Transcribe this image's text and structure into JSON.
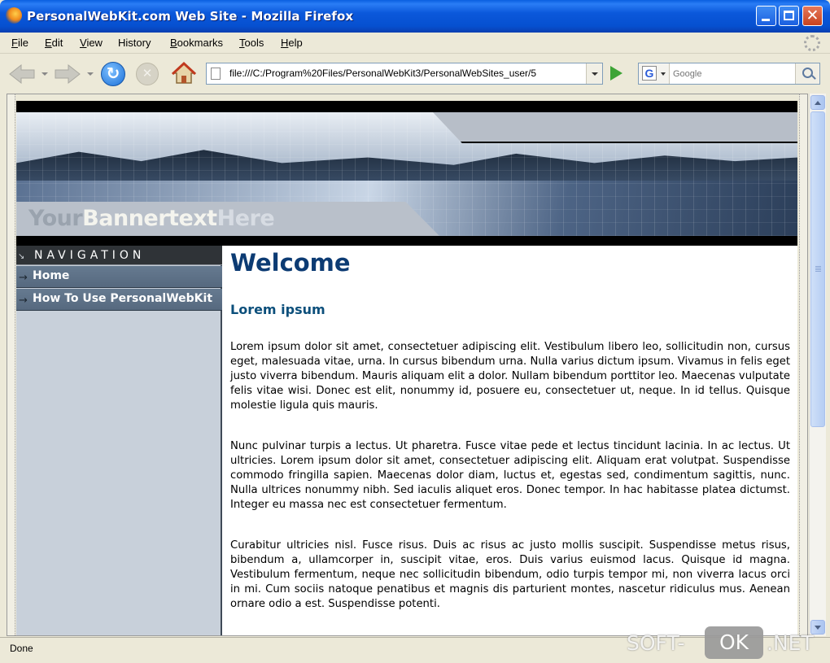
{
  "window": {
    "title": "PersonalWebKit.com Web Site - Mozilla Firefox",
    "close_glyph": "✕"
  },
  "menu": {
    "items": [
      {
        "label": "File",
        "accel": "F",
        "rest": "ile"
      },
      {
        "label": "Edit",
        "accel": "E",
        "rest": "dit"
      },
      {
        "label": "View",
        "accel": "V",
        "rest": "iew"
      },
      {
        "label": "History",
        "accel": "",
        "rest": "History"
      },
      {
        "label": "Bookmarks",
        "accel": "B",
        "rest": "ookmarks"
      },
      {
        "label": "Tools",
        "accel": "T",
        "rest": "ools"
      },
      {
        "label": "Help",
        "accel": "H",
        "rest": "elp"
      }
    ]
  },
  "toolbar": {
    "url": "file:///C:/Program%20Files/PersonalWebKit3/PersonalWebSites_user/5",
    "search_placeholder": "Google",
    "search_engine_letter": "G"
  },
  "site": {
    "banner": {
      "word1": "Your",
      "word2": "Bannertext",
      "word3": "Here"
    },
    "navigation": {
      "header": "Navigation",
      "corner": "↘",
      "arrow": "→",
      "items": [
        {
          "label": "Home"
        },
        {
          "label": "How To Use PersonalWebKit"
        }
      ]
    },
    "main": {
      "heading": "Welcome",
      "subheading": "Lorem ipsum",
      "paragraphs": [
        "Lorem ipsum dolor sit amet, consectetuer adipiscing elit. Vestibulum libero leo, sollicitudin non, cursus eget, malesuada vitae, urna. In cursus bibendum urna. Nulla varius dictum ipsum. Vivamus in felis eget justo viverra bibendum. Mauris aliquam elit a dolor. Nullam bibendum porttitor leo. Maecenas vulputate felis vitae wisi. Donec est elit, nonummy id, posuere eu, consectetuer ut, neque. In id tellus. Quisque molestie ligula quis mauris.",
        "Nunc pulvinar turpis a lectus. Ut pharetra. Fusce vitae pede et lectus tincidunt lacinia. In ac lectus. Ut ultricies. Lorem ipsum dolor sit amet, consectetuer adipiscing elit. Aliquam erat volutpat. Suspendisse commodo fringilla sapien. Maecenas dolor diam, luctus et, egestas sed, condimentum sagittis, nunc. Nulla ultrices nonummy nibh. Sed iaculis aliquet eros. Donec tempor. In hac habitasse platea dictumst. Integer eu massa nec est consectetuer fermentum.",
        "Curabitur ultricies nisl. Fusce risus. Duis ac risus ac justo mollis suscipit. Suspendisse metus risus, bibendum a, ullamcorper in, suscipit vitae, eros. Duis varius euismod lacus. Quisque id magna. Vestibulum fermentum, neque nec sollicitudin bibendum, odio turpis tempor mi, non viverra lacus orci in mi. Cum sociis natoque penatibus et magnis dis parturient montes, nascetur ridiculus mus. Aenean ornare odio a est. Suspendisse potenti."
      ]
    }
  },
  "status": {
    "text": "Done"
  },
  "watermark": {
    "part1": "SOFT-",
    "part2": "OK",
    "part3": ".NET"
  },
  "colors": {
    "titlebar": "#0b58db",
    "heading": "#0c3b73",
    "nav_item": "#5f7389",
    "sidebar": "#c8d0da"
  }
}
